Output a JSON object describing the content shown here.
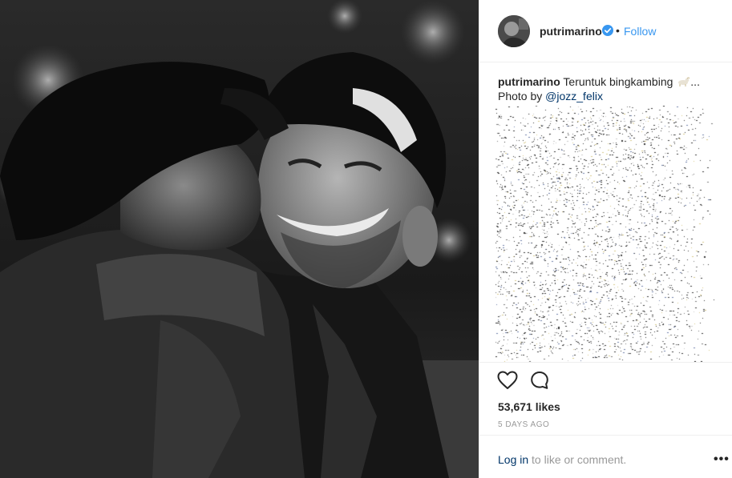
{
  "post": {
    "username": "putrimarino",
    "separator": "•",
    "follow_label": "Follow",
    "caption_text": "Teruntuk bingkambing",
    "caption_more": "...",
    "photo_by_prefix": "Photo by",
    "photo_by_mention": "@jozz_felix",
    "likes": "53,671 likes",
    "posted_ago": "5 DAYS AGO",
    "login_link": "Log in",
    "login_suffix": " to like or comment.",
    "more_label": "•••"
  },
  "icons": {
    "verified": "verified-badge-icon",
    "like": "heart-outline-icon",
    "comment": "speech-bubble-icon",
    "more": "ellipsis-icon",
    "caption_emoji": "goat-emoji-icon"
  },
  "colors": {
    "link_blue": "#3897f0",
    "mention_blue": "#003569",
    "text": "#262626",
    "muted": "#999999",
    "divider": "#efefef"
  }
}
